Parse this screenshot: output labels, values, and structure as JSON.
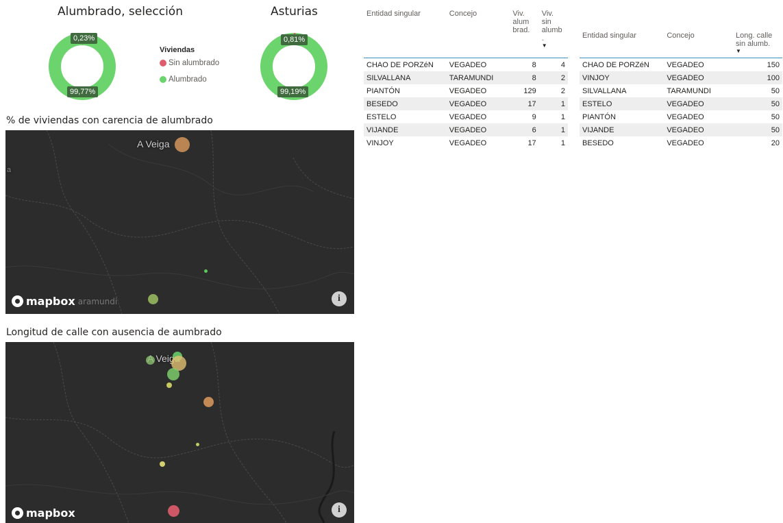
{
  "donut_left": {
    "title": "Alumbrado, selección",
    "sin_pct": "0,23%",
    "con_pct": "99,77%",
    "sin_value": 0.23,
    "con_value": 99.77
  },
  "donut_right": {
    "title": "Asturias",
    "sin_pct": "0,81%",
    "con_pct": "99,19%",
    "sin_value": 0.81,
    "con_value": 99.19
  },
  "legend": {
    "title": "Viviendas",
    "items": [
      {
        "label": "Sin alumbrado",
        "color": "#e05c6c"
      },
      {
        "label": "Alumbrado",
        "color": "#6cd46c"
      }
    ]
  },
  "colors": {
    "donut_green": "#6cd46c",
    "donut_red": "#e05c6c",
    "map_bg": "#2c2c2c",
    "header_rule": "#3a8fc0"
  },
  "map1": {
    "title": "% de viviendas con carencia de alumbrado",
    "place_label": "A Veiga",
    "edge_label_left": "a",
    "edge_label_bottom": "aramundi",
    "logo": "mapbox",
    "info": "i"
  },
  "map2": {
    "title": "Longitud de calle con ausencia de aumbrado",
    "place_label": "A Veiga",
    "logo": "mapbox",
    "info": "i"
  },
  "table1": {
    "headers": [
      "Entidad singular",
      "Concejo",
      "Viv. alum brad.",
      "Viv. sin alumb ."
    ],
    "sort_arrow": "▼",
    "rows": [
      [
        "CHAO DE PORZéN",
        "VEGADEO",
        "8",
        "4"
      ],
      [
        "SILVALLANA",
        "TARAMUNDI",
        "8",
        "2"
      ],
      [
        "PIANTÓN",
        "VEGADEO",
        "129",
        "2"
      ],
      [
        "BESEDO",
        "VEGADEO",
        "17",
        "1"
      ],
      [
        "ESTELO",
        "VEGADEO",
        "9",
        "1"
      ],
      [
        "VIJANDE",
        "VEGADEO",
        "6",
        "1"
      ],
      [
        "VINJOY",
        "VEGADEO",
        "17",
        "1"
      ]
    ]
  },
  "table2": {
    "headers": [
      "Entidad singular",
      "Concejo",
      "Long. calle sin alumb."
    ],
    "sort_arrow": "▼",
    "rows": [
      [
        "CHAO DE PORZéN",
        "VEGADEO",
        "150"
      ],
      [
        "VINJOY",
        "VEGADEO",
        "100"
      ],
      [
        "SILVALLANA",
        "TARAMUNDI",
        "50"
      ],
      [
        "ESTELO",
        "VEGADEO",
        "50"
      ],
      [
        "PIANTÓN",
        "VEGADEO",
        "50"
      ],
      [
        "VIJANDE",
        "VEGADEO",
        "50"
      ],
      [
        "BESEDO",
        "VEGADEO",
        "20"
      ]
    ]
  }
}
